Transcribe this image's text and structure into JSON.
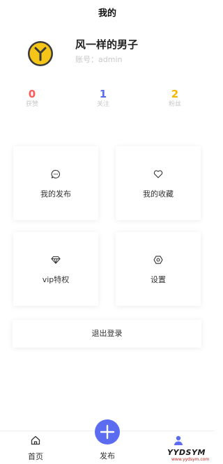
{
  "header": {
    "title": "我的"
  },
  "profile": {
    "name": "风一样的男子",
    "account": "账号：admin"
  },
  "stats": [
    {
      "value": "0",
      "label": "获赞",
      "color": "#ff5a5a"
    },
    {
      "value": "1",
      "label": "关注",
      "color": "#5b6cf0"
    },
    {
      "value": "2",
      "label": "粉丝",
      "color": "#f5b800"
    }
  ],
  "menu": [
    {
      "label": "我的发布",
      "icon": "chat-bubble-icon"
    },
    {
      "label": "我的收藏",
      "icon": "heart-icon"
    },
    {
      "label": "vip特权",
      "icon": "diamond-icon"
    },
    {
      "label": "设置",
      "icon": "settings-hexagon-icon"
    }
  ],
  "logout": {
    "label": "退出登录"
  },
  "tabbar": {
    "home": {
      "label": "首页",
      "icon": "home-icon"
    },
    "publish": {
      "label": "发布",
      "icon": "plus-icon"
    },
    "mine": {
      "label": "",
      "icon": "user-icon"
    }
  },
  "watermark": {
    "main": "YYDSYM",
    "sub": "www.yydsym.com"
  },
  "colors": {
    "accent": "#5b6cf0",
    "avatar_yellow": "#f5c518"
  }
}
